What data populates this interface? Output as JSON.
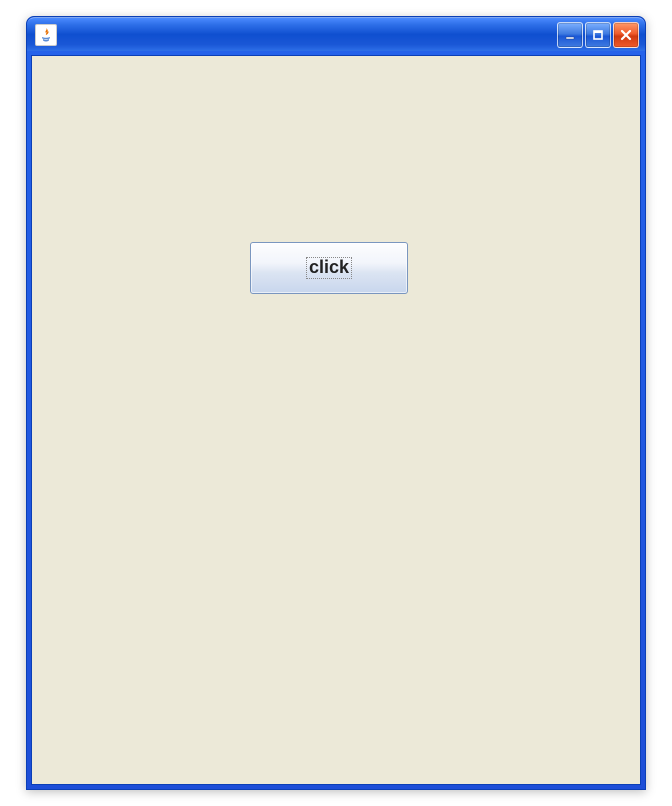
{
  "window": {
    "title": "",
    "icon": "java-icon",
    "controls": {
      "minimize": "minimize",
      "maximize": "maximize",
      "close": "close"
    }
  },
  "content": {
    "button_label": "click"
  }
}
